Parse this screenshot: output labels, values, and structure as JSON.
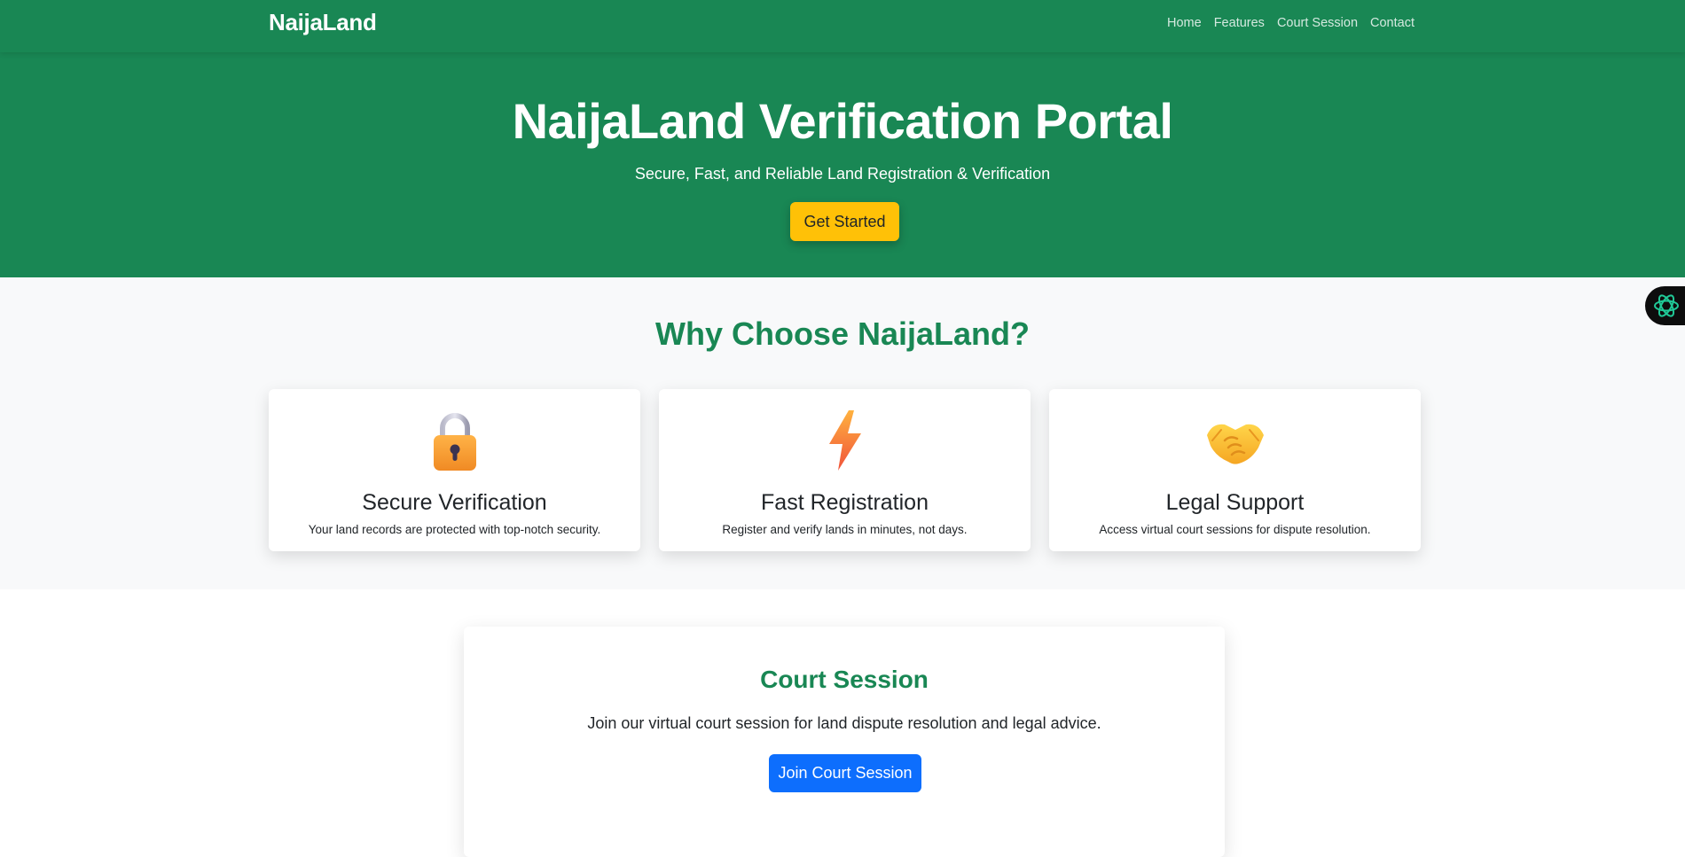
{
  "nav": {
    "brand": "NaijaLand",
    "links": [
      "Home",
      "Features",
      "Court Session",
      "Contact"
    ]
  },
  "hero": {
    "title": "NaijaLand Verification Portal",
    "subtitle": "Secure, Fast, and Reliable Land Registration & Verification",
    "cta": "Get Started"
  },
  "features": {
    "title": "Why Choose NaijaLand?",
    "cards": [
      {
        "icon": "lock-icon",
        "title": "Secure Verification",
        "text": "Your land records are protected with top-notch security."
      },
      {
        "icon": "lightning-icon",
        "title": "Fast Registration",
        "text": "Register and verify lands in minutes, not days."
      },
      {
        "icon": "handshake-icon",
        "title": "Legal Support",
        "text": "Access virtual court sessions for dispute resolution."
      }
    ]
  },
  "court": {
    "title": "Court Session",
    "text": "Join our virtual court session for land dispute resolution and legal advice.",
    "button": "Join Court Session"
  },
  "widget": {
    "icon": "assistant-icon"
  },
  "colors": {
    "primary_green": "#198754",
    "warning_yellow": "#ffc107",
    "primary_blue": "#0d6efd",
    "section_bg": "#f8f9fa"
  }
}
